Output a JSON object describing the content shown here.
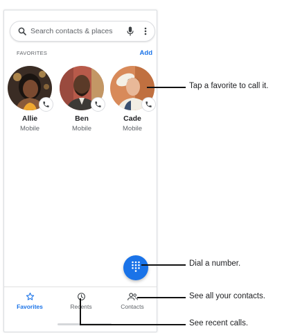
{
  "search": {
    "placeholder": "Search contacts & places"
  },
  "icons": {
    "search": "search-icon",
    "mic": "mic-icon",
    "more": "more-vert-icon",
    "phone": "phone-icon",
    "dialpad": "dialpad-icon",
    "favorites": "star-icon",
    "recents": "clock-icon",
    "contacts": "people-icon"
  },
  "favorites": {
    "title": "FAVORITES",
    "add_label": "Add",
    "items": [
      {
        "name": "Allie",
        "type": "Mobile"
      },
      {
        "name": "Ben",
        "type": "Mobile"
      },
      {
        "name": "Cade",
        "type": "Mobile"
      }
    ]
  },
  "nav": {
    "items": [
      {
        "label": "Favorites",
        "active": true
      },
      {
        "label": "Recents",
        "active": false
      },
      {
        "label": "Contacts",
        "active": false
      }
    ]
  },
  "callouts": {
    "favorite": "Tap a favorite to call it.",
    "dial": "Dial a number.",
    "contacts": "See all your contacts.",
    "recents": "See recent calls."
  },
  "colors": {
    "accent": "#1a73e8",
    "text": "#202124",
    "secondary": "#5f6368"
  }
}
